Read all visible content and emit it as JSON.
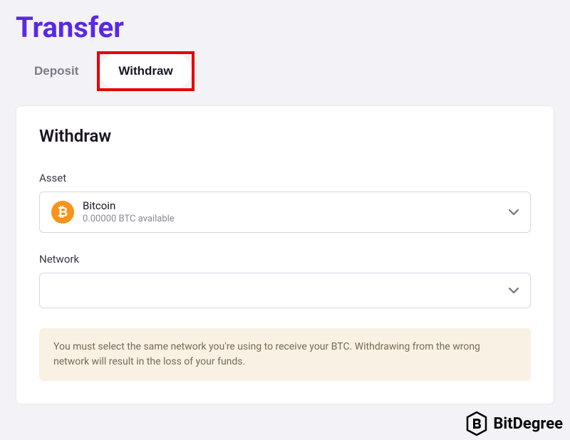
{
  "page": {
    "title": "Transfer"
  },
  "tabs": {
    "deposit": "Deposit",
    "withdraw": "Withdraw"
  },
  "card": {
    "title": "Withdraw"
  },
  "asset": {
    "label": "Asset",
    "name": "Bitcoin",
    "available": "0.00000 BTC available",
    "icon_symbol": "₿"
  },
  "network": {
    "label": "Network"
  },
  "warning": {
    "text": "You must select the same network you're using to receive your BTC. Withdrawing from the wrong network will result in the loss of your funds."
  },
  "watermark": {
    "text": "BitDegree"
  }
}
